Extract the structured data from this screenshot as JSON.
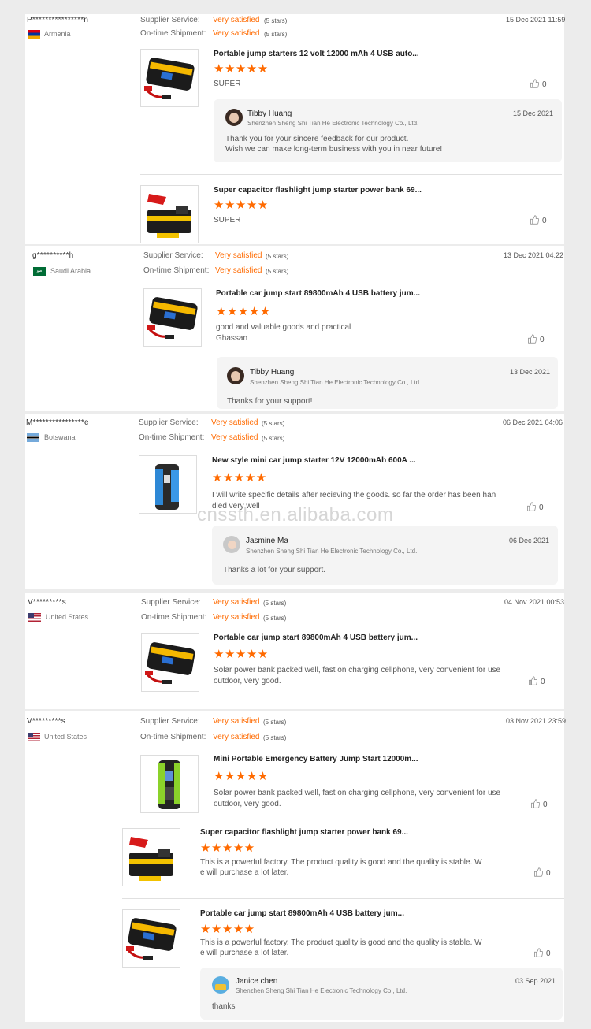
{
  "labels": {
    "supplier_service": "Supplier Service:",
    "on_time_shipment": "On-time Shipment:",
    "very_satisfied": "Very satisfied",
    "five_stars": "(5 stars)",
    "stars_glyph": "★★★★★"
  },
  "reviews": [
    {
      "buyer": "P****************n",
      "country": "Armenia",
      "date": "15 Dec 2021 11:59",
      "items": [
        {
          "title": "Portable jump starters 12 volt 12000 mAh 4 USB auto...",
          "text": "SUPER",
          "likes": "0"
        },
        {
          "title": "Super capacitor flashlight jump starter power bank 69...",
          "text": "SUPER",
          "likes": "0"
        }
      ],
      "reply": {
        "name": "Tibby Huang",
        "company": "Shenzhen Sheng Shi Tian He Electronic Technology Co., Ltd.",
        "date": "15 Dec 2021",
        "line1": "Thank you for your sincere feedback for our product.",
        "line2": "Wish we can make long-term business with you in near future!"
      }
    },
    {
      "buyer": "g**********h",
      "country": "Saudi Arabia",
      "date": "13 Dec 2021 04:22",
      "items": [
        {
          "title": "Portable car jump start 89800mAh 4 USB battery jum...",
          "text": "good and valuable goods and practical",
          "text2": "Ghassan",
          "likes": "0"
        }
      ],
      "reply": {
        "name": "Tibby Huang",
        "company": "Shenzhen Sheng Shi Tian He Electronic Technology Co., Ltd.",
        "date": "13 Dec 2021",
        "line1": "Thanks for your support!"
      }
    },
    {
      "buyer": "M****************e",
      "country": "Botswana",
      "date": "06 Dec 2021 04:06",
      "items": [
        {
          "title": "New style mini car jump starter 12V 12000mAh 600A ...",
          "text": "I will write specific details after recieving the goods. so far the order has been han",
          "text2": "dled very well",
          "likes": "0"
        }
      ],
      "reply": {
        "name": "Jasmine Ma",
        "company": "Shenzhen Sheng Shi Tian He Electronic Technology Co., Ltd.",
        "date": "06 Dec 2021",
        "line1": "Thanks a lot for your support."
      }
    },
    {
      "buyer": "V*********s",
      "country": "United States",
      "date": "04 Nov 2021 00:53",
      "items": [
        {
          "title": "Portable car jump start 89800mAh 4 USB battery jum...",
          "text": "Solar power bank packed well, fast on charging cellphone, very convenient for use",
          "text2": "outdoor, very good.",
          "likes": "0"
        }
      ]
    },
    {
      "buyer": "V*********s",
      "country": "United States",
      "date": "03 Nov 2021 23:59",
      "items": [
        {
          "title": "Mini Portable Emergency Battery Jump Start 12000m...",
          "text": "Solar power bank packed well, fast on charging cellphone, very convenient for use",
          "text2": "outdoor, very good.",
          "likes": "0"
        },
        {
          "title": "Super capacitor flashlight jump starter power bank 69...",
          "text": "This is a powerful factory. The product quality is good and the quality is stable. W",
          "text2": "e will purchase a lot later.",
          "likes": "0"
        },
        {
          "title": "Portable car jump start 89800mAh 4 USB battery jum...",
          "text": "This is a powerful factory. The product quality is good and the quality is stable. W",
          "text2": "e will purchase a lot later.",
          "likes": "0"
        }
      ],
      "reply": {
        "name": "Janice chen",
        "company": "Shenzhen Sheng Shi Tian He Electronic Technology Co., Ltd.",
        "date": "03 Sep 2021",
        "line1": "thanks"
      }
    }
  ],
  "watermark": "cnssth.en.alibaba.com"
}
